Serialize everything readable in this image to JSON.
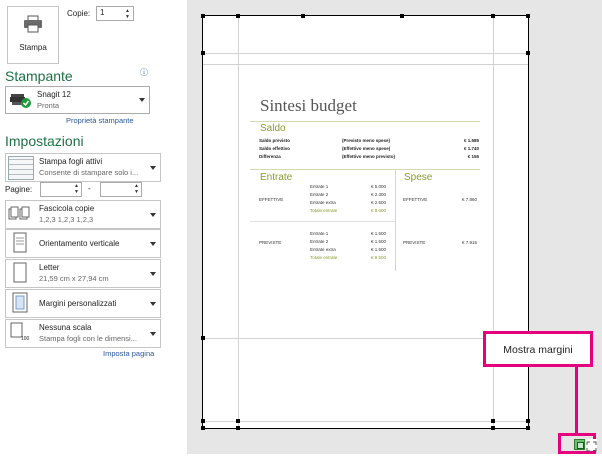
{
  "print_button": {
    "label": "Stampa"
  },
  "copies": {
    "label": "Copie:",
    "value": "1"
  },
  "printer_section": {
    "title": "Stampante",
    "info": "ⓘ"
  },
  "printer": {
    "name": "Snagit 12",
    "status": "Pronta",
    "properties_link": "Proprietà stampante"
  },
  "settings_section": {
    "title": "Impostazioni"
  },
  "settings": {
    "print_what": {
      "line1": "Stampa fogli attivi",
      "line2": "Consente di stampare solo i..."
    },
    "pages": {
      "label": "Pagine:",
      "separator": "-"
    },
    "collate": {
      "line1": "Fascicola copie",
      "line2": "1,2,3    1,2,3    1,2,3"
    },
    "orientation": {
      "line1": "Orientamento verticale"
    },
    "paper": {
      "line1": "Letter",
      "line2": "21,59 cm x 27,94 cm"
    },
    "margins": {
      "line1": "Margini personalizzati"
    },
    "scaling": {
      "line1": "Nessuna scala",
      "line2": "Stampa fogli con le dimensi...",
      "icon_text": "100"
    }
  },
  "page_setup_link": "Imposta pagina",
  "preview": {
    "title": "Sintesi budget",
    "saldo": {
      "title": "Saldo",
      "rows": [
        {
          "label": "Saldo previsto",
          "desc": "(Previsto meno spese)",
          "value": "€ 1.585"
        },
        {
          "label": "Saldo effettivo",
          "desc": "(Effettivo meno spese)",
          "value": "€ 1.740"
        },
        {
          "label": "Differenza",
          "desc": "(Effettivo meno previsto)",
          "value": "€ 155"
        }
      ]
    },
    "entrate": {
      "title": "Entrate",
      "groups": [
        {
          "label": "EFFETTIVE",
          "rows": [
            {
              "label": "Entrate 1",
              "value": "€ 5.000"
            },
            {
              "label": "Entrate 2",
              "value": "€ 2.300"
            },
            {
              "label": "Entrate extra",
              "value": "€ 2.500"
            },
            {
              "label": "Totale entrate",
              "value": "€ 9.600"
            }
          ]
        },
        {
          "label": "PREVISTE",
          "rows": [
            {
              "label": "Entrate 1",
              "value": "€ 1.500"
            },
            {
              "label": "Entrate 2",
              "value": "€ 1.500"
            },
            {
              "label": "Entrate extra",
              "value": "€ 1.500"
            },
            {
              "label": "Totale entrate",
              "value": "€ 9.500"
            }
          ]
        }
      ]
    },
    "spese": {
      "title": "Spese",
      "rows": [
        {
          "label": "EFFETTIVE",
          "value": "€ 7.860"
        },
        {
          "label": "PREVISTE",
          "value": "€ 7.915"
        }
      ]
    }
  },
  "callout": {
    "label": "Mostra margini"
  },
  "colors": {
    "accent_green": "#1e7145",
    "callout_magenta": "#e5007e",
    "link_blue": "#2b579a"
  }
}
